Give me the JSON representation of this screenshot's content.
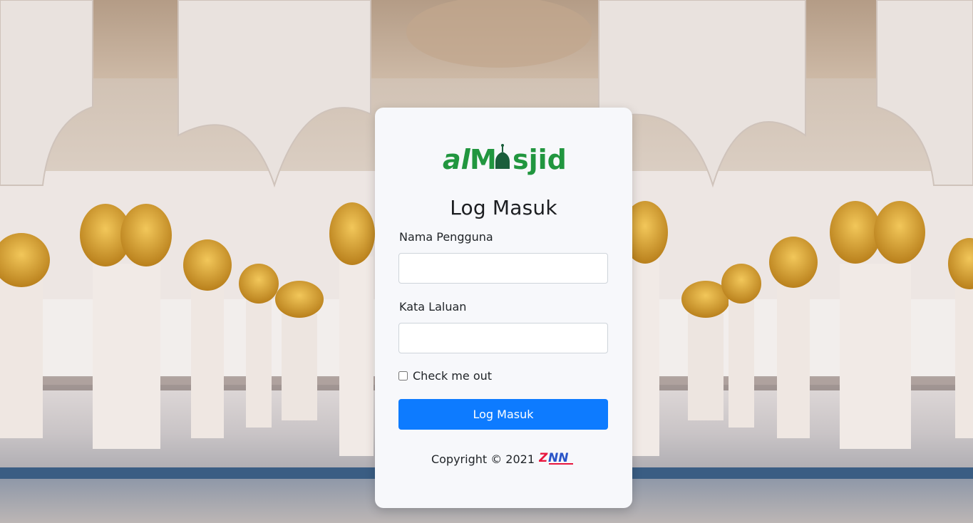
{
  "brand": {
    "logo_text_prefix": "al",
    "logo_text_suffix": "sjid",
    "logo_color": "#21963f",
    "logo_icon": "mosque-dome-icon"
  },
  "login": {
    "title": "Log Masuk",
    "username_label": "Nama Pengguna",
    "username_value": "",
    "password_label": "Kata Laluan",
    "password_value": "",
    "remember_label": "Check me out",
    "remember_checked": false,
    "submit_label": "Log Masuk",
    "submit_color": "#0d7bff"
  },
  "footer": {
    "copyright": "Copyright © 2021",
    "company_logo": "ZNN",
    "company_logo_colors": [
      "#e8173f",
      "#2a55c8"
    ]
  },
  "background": {
    "description_icon": "mosque-colonnade-photo"
  }
}
